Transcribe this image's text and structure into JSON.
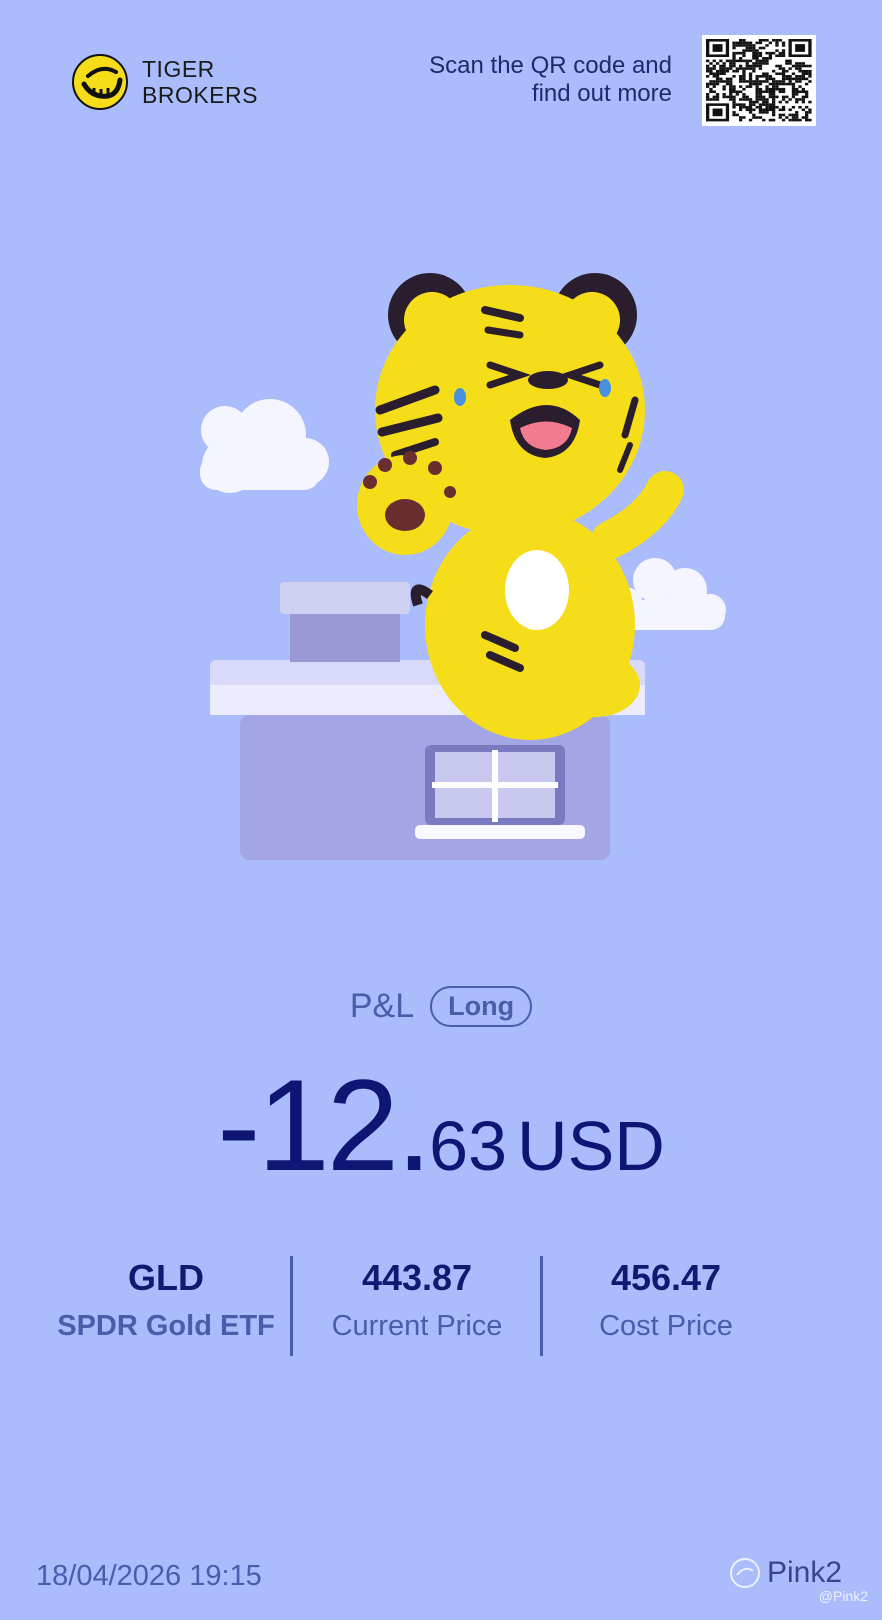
{
  "brand": {
    "name_line1": "TIGER",
    "name_line2": "BROKERS"
  },
  "qr": {
    "text_line1": "Scan the QR code and",
    "text_line2": "find out more"
  },
  "pnl": {
    "label": "P&L",
    "badge": "Long",
    "sign_int": "-12.",
    "decimals": "63",
    "currency": "USD"
  },
  "stats": [
    {
      "value": "GLD",
      "label": "SPDR Gold ETF"
    },
    {
      "value": "443.87",
      "label": "Current Price"
    },
    {
      "value": "456.47",
      "label": "Cost Price"
    }
  ],
  "footer": {
    "timestamp": "18/04/2026 19:15",
    "username": "Pink2",
    "watermark": "@Pink2"
  },
  "colors": {
    "background": "#aabcfc",
    "accent": "#0e1573",
    "muted": "#4b5cab",
    "brand_yellow": "#f5dd1a"
  },
  "icons": {
    "logo": "tiger-stripe-logo-icon",
    "qr": "qr-code-icon",
    "avatar": "user-avatar-icon"
  }
}
